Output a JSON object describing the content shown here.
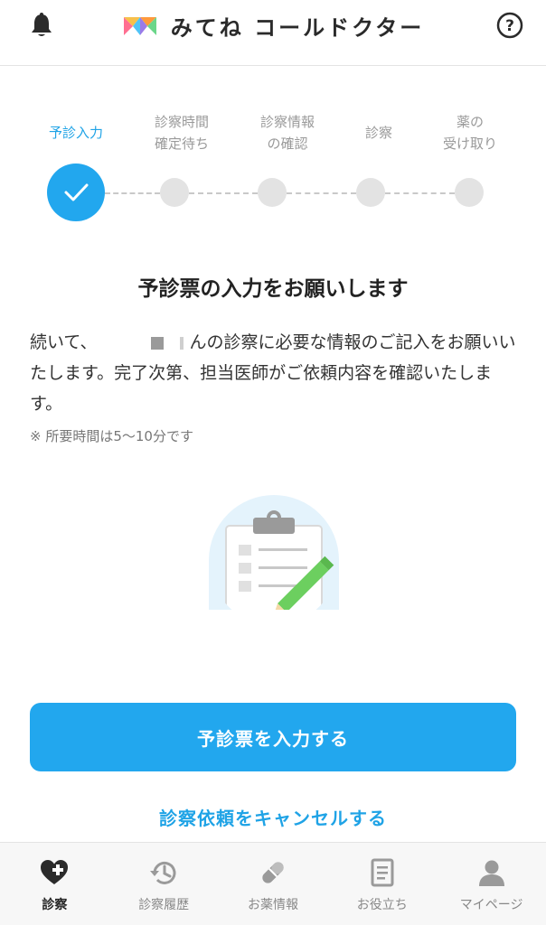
{
  "header": {
    "title": "みてね コールドクター",
    "bell_icon": "bell-icon",
    "help_icon": "question-circle-icon"
  },
  "stepper": {
    "steps": [
      {
        "label_line1": "予診入力",
        "label_line2": "",
        "state": "completed"
      },
      {
        "label_line1": "診察時間",
        "label_line2": "確定待ち",
        "state": "pending"
      },
      {
        "label_line1": "診察情報",
        "label_line2": "の確認",
        "state": "pending"
      },
      {
        "label_line1": "診察",
        "label_line2": "",
        "state": "pending"
      },
      {
        "label_line1": "薬の",
        "label_line2": "受け取り",
        "state": "pending"
      }
    ]
  },
  "content": {
    "heading": "予診票の入力をお願いします",
    "body_prefix": "続いて、",
    "body_main": "んの診察に必要な情報のご記入をお願いいたします。完了次第、担当医師がご依頼内容を確認いたします。",
    "note": "※ 所要時間は5〜10分です"
  },
  "actions": {
    "primary_label": "予診票を入力する",
    "cancel_label": "診察依頼をキャンセルする"
  },
  "tabbar": {
    "items": [
      {
        "label": "診察",
        "icon": "heart-plus-icon",
        "active": true
      },
      {
        "label": "診察履歴",
        "icon": "history-icon",
        "active": false
      },
      {
        "label": "お薬情報",
        "icon": "pill-icon",
        "active": false
      },
      {
        "label": "お役立ち",
        "icon": "document-icon",
        "active": false
      },
      {
        "label": "マイページ",
        "icon": "person-icon",
        "active": false
      }
    ]
  },
  "colors": {
    "accent": "#22a7ee",
    "inactive_dot": "#e3e3e3"
  }
}
